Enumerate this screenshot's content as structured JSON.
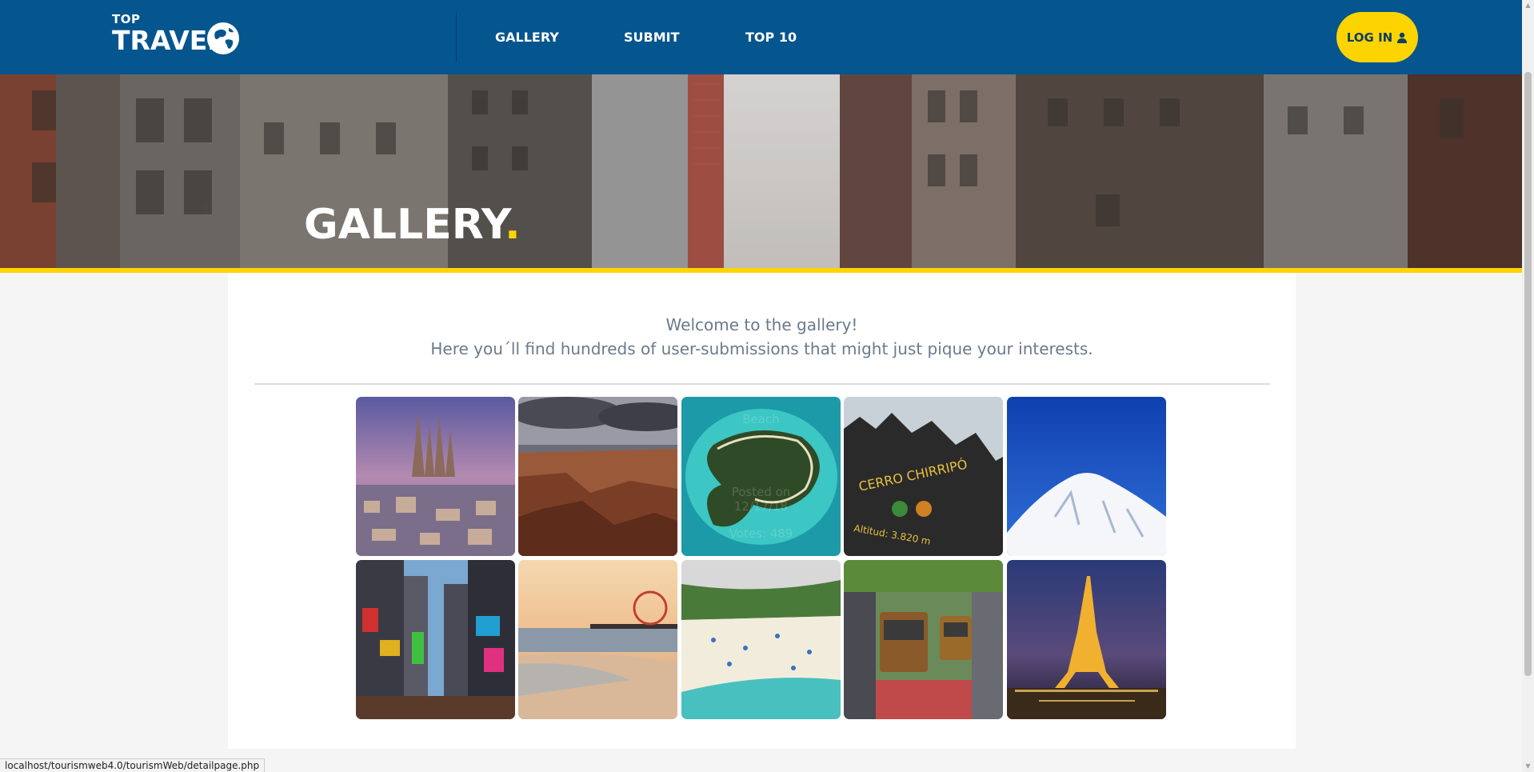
{
  "header": {
    "logo_small": "TOP",
    "logo_main": "TRAVEL",
    "nav": [
      {
        "label": "GALLERY"
      },
      {
        "label": "SUBMIT"
      },
      {
        "label": "TOP 10"
      }
    ],
    "login_label": "LOG IN",
    "login_icon": "user-icon"
  },
  "hero": {
    "title": "GALLERY",
    "dot": ".",
    "colors": {
      "accent": "#fed400",
      "header": "#05558f"
    }
  },
  "intro": {
    "line1": "Welcome to the gallery!",
    "line2": "Here you´ll find hundreds of user-submissions that might just pique your interests."
  },
  "gallery": {
    "hover_card": {
      "title": "Beach",
      "posted_line1": "Posted on",
      "posted_line2": "12/17/18",
      "votes": "Votes: 489"
    }
  },
  "status_bar": {
    "url": "localhost/tourismweb4.0/tourismWeb/detailpage.php"
  }
}
